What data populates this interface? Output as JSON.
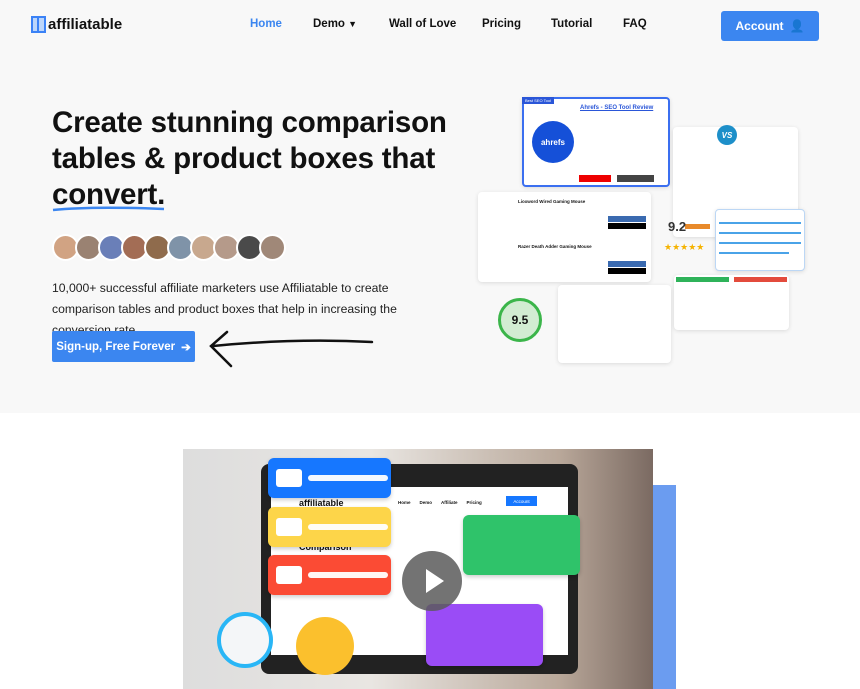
{
  "brand": {
    "name": "affiliatable"
  },
  "nav": {
    "items": [
      "Home",
      "Demo",
      "Wall of Love",
      "Pricing",
      "Tutorial",
      "FAQ"
    ],
    "active": "Home",
    "account": "Account"
  },
  "hero": {
    "line1": "Create stunning comparison",
    "line2": "tables & product boxes that",
    "line3": "convert.",
    "description": "10,000+ successful affiliate marketers use Affiliatable to create comparison tables and product boxes that help in increasing the conversion rate.",
    "cta": "Sign-up, Free Forever"
  },
  "collage": {
    "review_title": "Ahrefs - SEO Tool Review",
    "review_badge": "Best SEO Tool",
    "logo_text": "ahrefs",
    "vs": "VS",
    "product1": "Lioxword Wired Gaming Mouse",
    "product2": "Razer Death Adder Gaming Mouse",
    "score_big": "9.2",
    "score_ring": "9.5"
  },
  "video": {
    "brand": "affiliatable",
    "heading": "Comparison",
    "nav": [
      "Home",
      "Demo",
      "Affiliate",
      "Pricing"
    ],
    "account": "Account"
  },
  "colors": {
    "accent": "#3b86f0",
    "active_nav": "#3b86f0"
  }
}
